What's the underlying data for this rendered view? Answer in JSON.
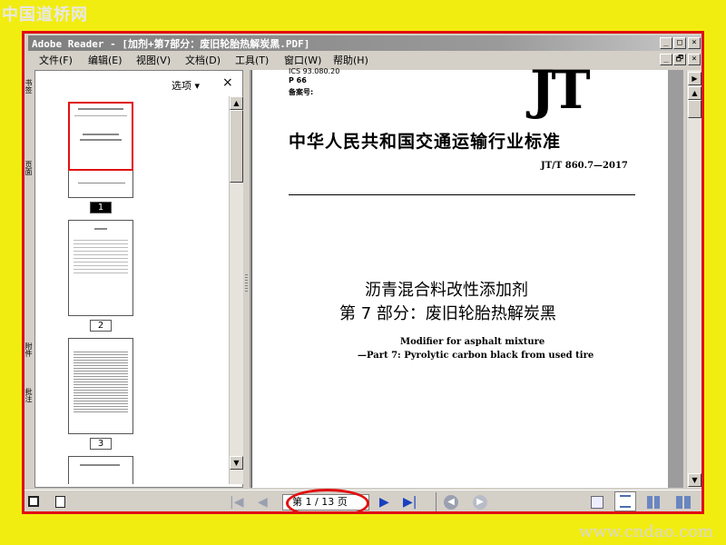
{
  "watermarks": {
    "top": "中国道桥网",
    "bottom": "www.cndao.com"
  },
  "window": {
    "title": "Adobe Reader - [加剂+第7部分：废旧轮胎热解炭黑.PDF]",
    "controls": [
      "_",
      "□",
      "×"
    ],
    "doc_controls": [
      "_",
      "🗗",
      "×"
    ]
  },
  "menu": [
    {
      "label": "文件(F)"
    },
    {
      "label": "编辑(E)"
    },
    {
      "label": "视图(V)"
    },
    {
      "label": "文档(D)"
    },
    {
      "label": "工具(T)"
    },
    {
      "label": "窗口(W)"
    },
    {
      "label": "帮助(H)"
    }
  ],
  "left_tabs": [
    "书签",
    "页面",
    "附件",
    "批注"
  ],
  "thumb_panel": {
    "options_label": "选项 ▾",
    "close_label": "×",
    "pages": [
      "1",
      "2",
      "3"
    ],
    "selected_page": "1"
  },
  "document": {
    "header_lines": [
      "ICS 93.080.20",
      "P 66",
      "备案号:"
    ],
    "logo": "JT",
    "org_title": "中华人民共和国交通运输行业标准",
    "std_number": "JT/T 860.7—2017",
    "title_line1": "沥青混合料改性添加剂",
    "title_line2": "第 7 部分：废旧轮胎热解炭黑",
    "en_line1": "Modifier for asphalt mixture",
    "en_line2": "—Part 7: Pyrolytic carbon black from used tire"
  },
  "status": {
    "page_indicator": "第 1 / 13 页"
  },
  "colors": {
    "highlight": "#e01010",
    "background": "#f2ed10"
  }
}
